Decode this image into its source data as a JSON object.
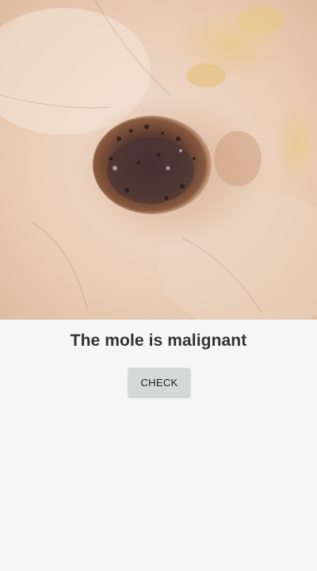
{
  "image": {
    "semantic": "dermoscopy-skin-lesion-photo"
  },
  "result": {
    "text": "The mole is malignant"
  },
  "check_button": {
    "label": "CHECK"
  },
  "colors": {
    "background": "#f6f6f6",
    "button_bg": "#d6d7d7",
    "text": "#333333"
  }
}
